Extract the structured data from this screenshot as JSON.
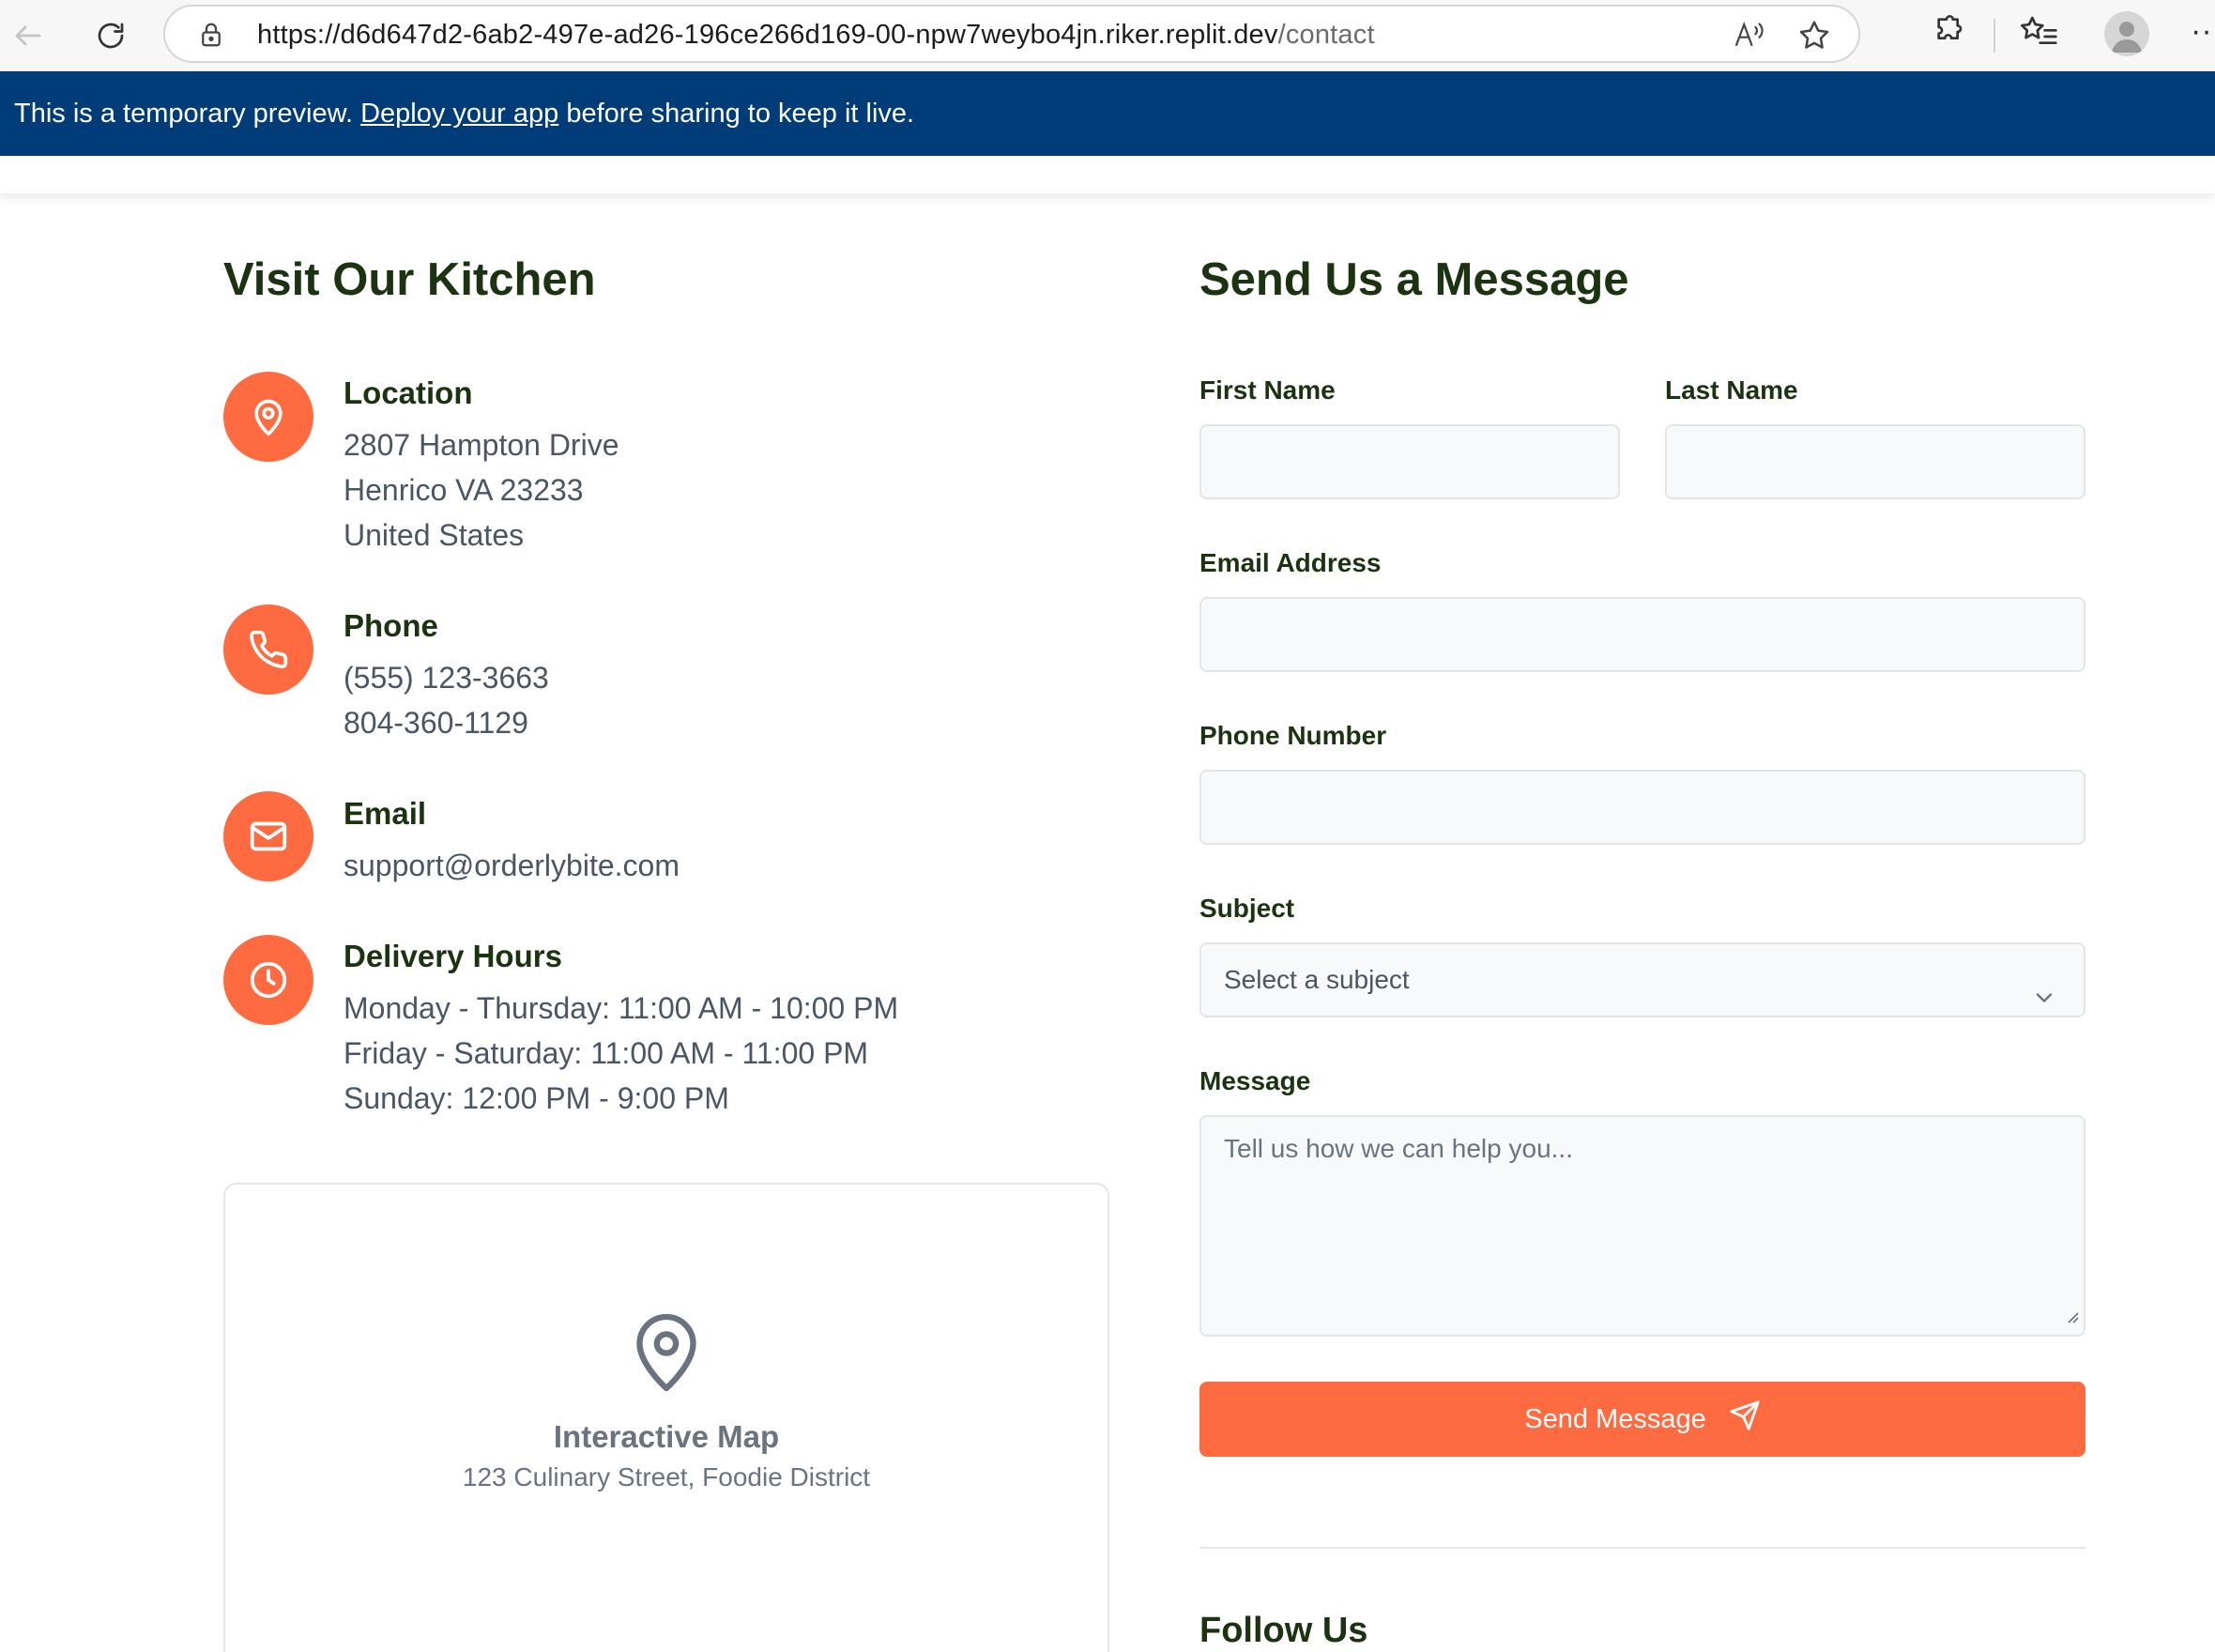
{
  "browser": {
    "url_host": "https://d6d647d2-6ab2-497e-ad26-196ce266d169-00-npw7weybo4jn.riker.replit.dev",
    "url_path": "/contact",
    "more_label": "···"
  },
  "banner": {
    "text_before": "This is a temporary preview. ",
    "link_text": "Deploy your app",
    "text_after": " before sharing to keep it live."
  },
  "contact_info": {
    "heading": "Visit Our Kitchen",
    "location": {
      "title": "Location",
      "lines": [
        "2807 Hampton Drive",
        "Henrico VA 23233",
        "United States"
      ]
    },
    "phone": {
      "title": "Phone",
      "lines": [
        "(555) 123-3663",
        "804-360-1129"
      ]
    },
    "email": {
      "title": "Email",
      "lines": [
        "support@orderlybite.com"
      ]
    },
    "hours": {
      "title": "Delivery Hours",
      "lines": [
        "Monday - Thursday: 11:00 AM - 10:00 PM",
        "Friday - Saturday: 11:00 AM - 11:00 PM",
        "Sunday: 12:00 PM - 9:00 PM"
      ]
    },
    "map": {
      "title": "Interactive Map",
      "address": "123 Culinary Street, Foodie District"
    }
  },
  "form": {
    "heading": "Send Us a Message",
    "first_name_label": "First Name",
    "first_name_value": "",
    "last_name_label": "Last Name",
    "last_name_value": "",
    "email_label": "Email Address",
    "email_value": "",
    "phone_label": "Phone Number",
    "phone_value": "",
    "subject_label": "Subject",
    "subject_selected": "Select a subject",
    "message_label": "Message",
    "message_placeholder": "Tell us how we can help you...",
    "send_label": "Send Message"
  },
  "follow": {
    "heading": "Follow Us"
  },
  "colors": {
    "accent": "#ff6b40",
    "heading": "#1b3311",
    "banner": "#003c78"
  }
}
